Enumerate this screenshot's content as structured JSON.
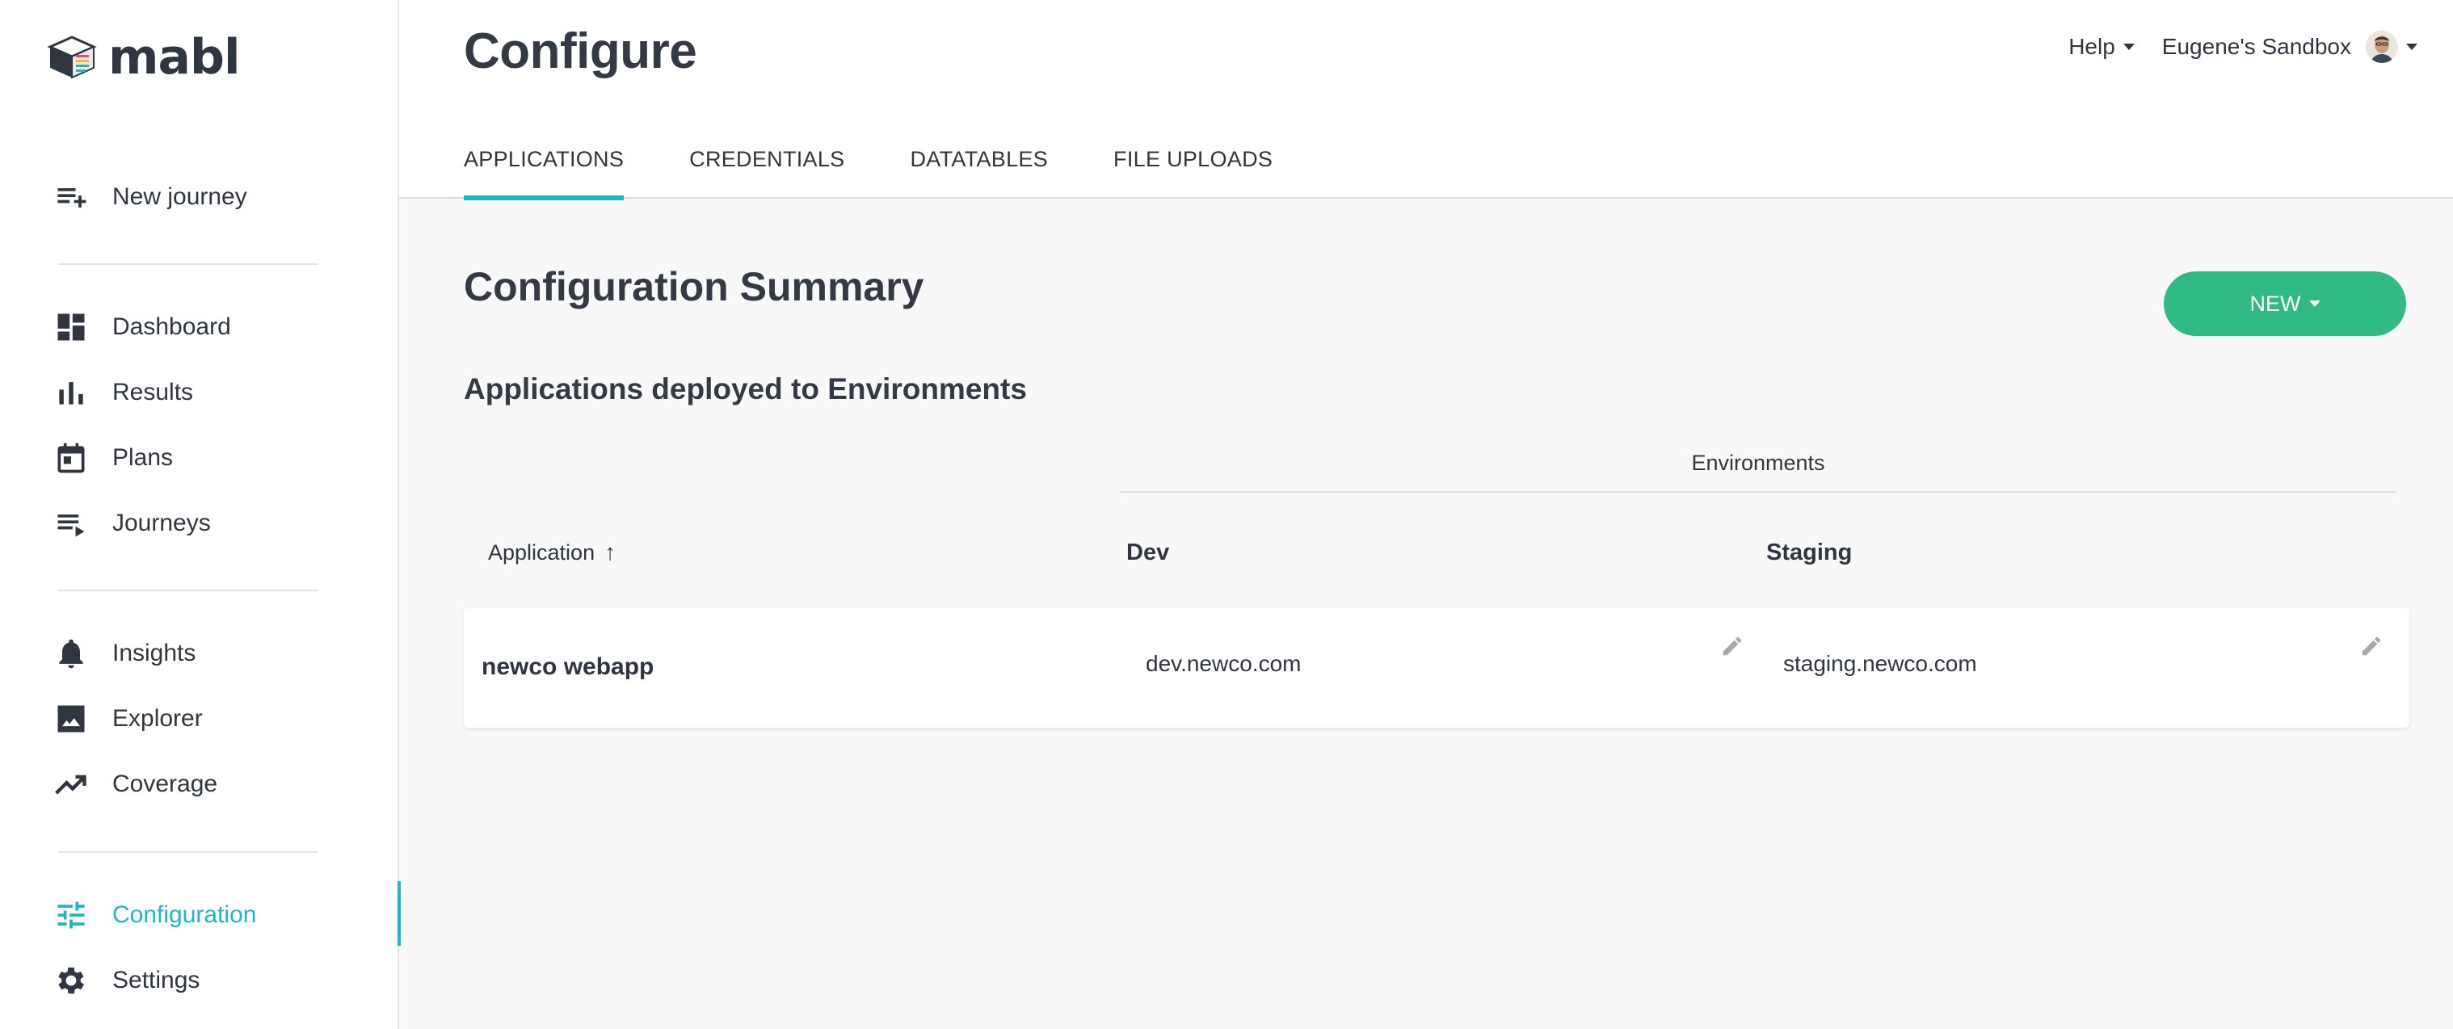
{
  "brand": {
    "name": "mabl"
  },
  "sidebar": {
    "new_journey": "New journey",
    "items_group1": [
      {
        "label": "Dashboard",
        "icon": "dashboard-icon"
      },
      {
        "label": "Results",
        "icon": "bar-chart-icon"
      },
      {
        "label": "Plans",
        "icon": "calendar-icon"
      },
      {
        "label": "Journeys",
        "icon": "playlist-icon"
      }
    ],
    "items_group2": [
      {
        "label": "Insights",
        "icon": "bell-icon"
      },
      {
        "label": "Explorer",
        "icon": "image-icon"
      },
      {
        "label": "Coverage",
        "icon": "trending-up-icon"
      }
    ],
    "items_group3": [
      {
        "label": "Configuration",
        "icon": "sliders-icon",
        "active": true
      },
      {
        "label": "Settings",
        "icon": "gear-icon"
      }
    ]
  },
  "header": {
    "title": "Configure",
    "help_label": "Help",
    "workspace_label": "Eugene's Sandbox",
    "tabs": [
      {
        "label": "APPLICATIONS",
        "active": true
      },
      {
        "label": "CREDENTIALS"
      },
      {
        "label": "DATATABLES"
      },
      {
        "label": "FILE UPLOADS"
      }
    ]
  },
  "main": {
    "section_title": "Configuration Summary",
    "new_button": "NEW",
    "subheading": "Applications deployed to Environments",
    "environments_label": "Environments",
    "columns": {
      "application": "Application",
      "sort_arrow": "↑",
      "dev": "Dev",
      "staging": "Staging"
    },
    "rows": [
      {
        "application": "newco webapp",
        "dev": "dev.newco.com",
        "staging": "staging.newco.com"
      }
    ]
  },
  "colors": {
    "accent": "#1fb7c8",
    "primary_button": "#2fb983",
    "text": "#2f3640"
  }
}
